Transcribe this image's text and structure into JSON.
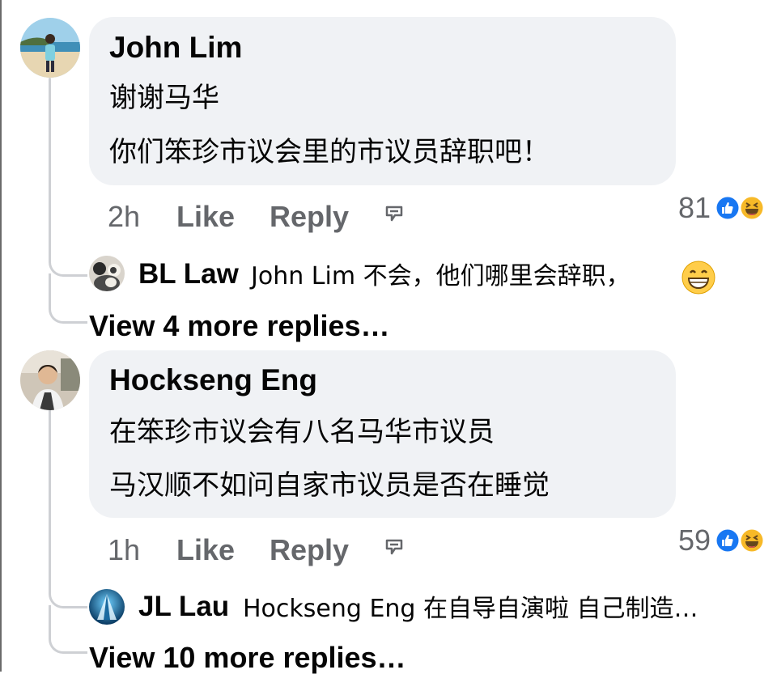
{
  "comments": [
    {
      "author": "John Lim",
      "lines": [
        "谢谢马华",
        "你们笨珍市议会里的市议员辞职吧！"
      ],
      "time": "2h",
      "like_label": "Like",
      "reply_label": "Reply",
      "reaction_count": "81",
      "reactions": [
        "like-icon",
        "haha-icon"
      ],
      "reply_preview": {
        "author": "BL Law",
        "text": "John Lim 不会，他们哪里会辞职，",
        "emoji": "grin-emoji"
      },
      "view_more": "View 4 more replies…"
    },
    {
      "author": "Hockseng Eng",
      "lines": [
        "在笨珍市议会有八名马华市议员",
        "马汉顺不如问自家市议员是否在睡觉"
      ],
      "time": "1h",
      "like_label": "Like",
      "reply_label": "Reply",
      "reaction_count": "59",
      "reactions": [
        "like-icon",
        "haha-icon"
      ],
      "reply_preview": {
        "author": "JL Lau",
        "text": "Hockseng Eng 在自导自演啦  自己制造…"
      },
      "view_more": "View 10 more replies…"
    }
  ],
  "colors": {
    "bubble": "#f0f2f5",
    "meta_text": "#65676b",
    "like_blue": "#1877f2",
    "haha_yellow": "#f7b928",
    "thread_line": "#ced0d4"
  }
}
